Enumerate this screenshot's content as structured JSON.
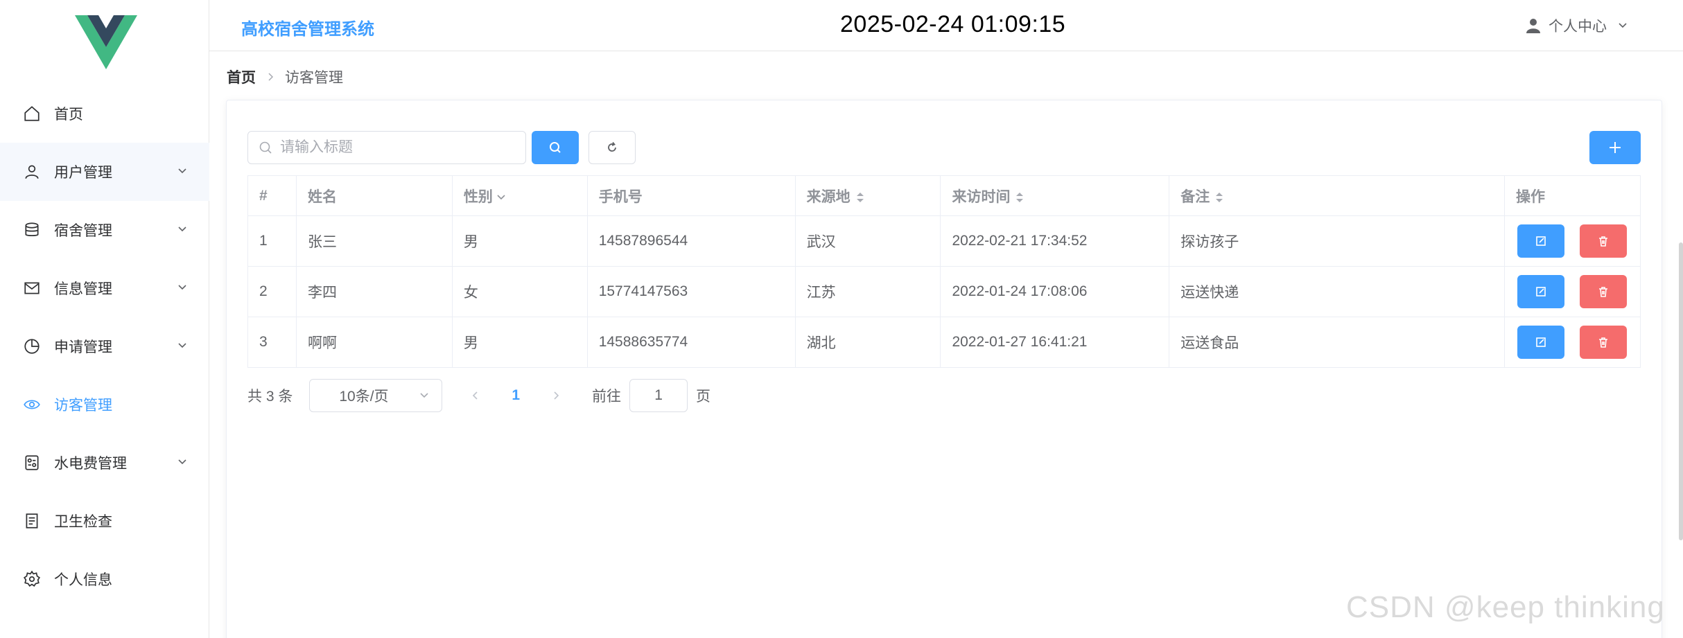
{
  "app": {
    "title": "高校宿舍管理系统",
    "clock": "2025-02-24 01:09:15",
    "user_menu": "个人中心"
  },
  "sidebar": {
    "items": [
      {
        "label": "首页",
        "icon": "home-icon",
        "has_sub": false
      },
      {
        "label": "用户管理",
        "icon": "user-icon",
        "has_sub": true
      },
      {
        "label": "宿舍管理",
        "icon": "database-icon",
        "has_sub": true
      },
      {
        "label": "信息管理",
        "icon": "message-icon",
        "has_sub": true
      },
      {
        "label": "申请管理",
        "icon": "pie-chart-icon",
        "has_sub": true
      },
      {
        "label": "访客管理",
        "icon": "eye-icon",
        "has_sub": false,
        "active": true
      },
      {
        "label": "水电费管理",
        "icon": "meter-icon",
        "has_sub": true
      },
      {
        "label": "卫生检查",
        "icon": "document-icon",
        "has_sub": false
      },
      {
        "label": "个人信息",
        "icon": "gear-icon",
        "has_sub": false
      }
    ]
  },
  "breadcrumb": {
    "home": "首页",
    "current": "访客管理"
  },
  "toolbar": {
    "search_placeholder": "请输入标题"
  },
  "table": {
    "headers": {
      "index": "#",
      "name": "姓名",
      "gender": "性别",
      "phone": "手机号",
      "origin": "来源地",
      "visit_time": "来访时间",
      "remark": "备注",
      "actions": "操作"
    },
    "rows": [
      {
        "index": "1",
        "name": "张三",
        "gender": "男",
        "phone": "14587896544",
        "origin": "武汉",
        "visit_time": "2022-02-21 17:34:52",
        "remark": "探访孩子"
      },
      {
        "index": "2",
        "name": "李四",
        "gender": "女",
        "phone": "15774147563",
        "origin": "江苏",
        "visit_time": "2022-01-24 17:08:06",
        "remark": "运送快递"
      },
      {
        "index": "3",
        "name": "啊啊",
        "gender": "男",
        "phone": "14588635774",
        "origin": "湖北",
        "visit_time": "2022-01-27 16:41:21",
        "remark": "运送食品"
      }
    ]
  },
  "pagination": {
    "total": "共 3 条",
    "page_size": "10条/页",
    "current_page": "1",
    "goto_label": "前往",
    "goto_value": "1",
    "page_suffix": "页"
  },
  "watermark": "CSDN @keep   thinking",
  "colors": {
    "primary": "#409eff",
    "danger": "#f56c6c",
    "logo_green": "#41b883",
    "logo_dark": "#34495e"
  }
}
